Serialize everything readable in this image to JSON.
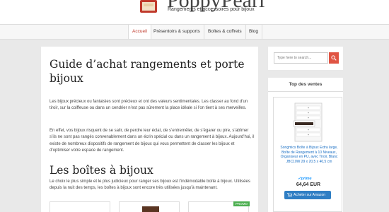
{
  "header": {
    "site_name": "PoppyPearl",
    "tagline": "Rangements et accessoires pour bijoux"
  },
  "nav": {
    "items": [
      {
        "label": "Accueil",
        "active": true
      },
      {
        "label": "Présentoirs & supports",
        "active": false
      },
      {
        "label": "Boîtes & coffrets",
        "active": false
      },
      {
        "label": "Blog",
        "active": false
      }
    ]
  },
  "article": {
    "title": "Guide d’achat rangements et porte bijoux",
    "paragraphs": [
      "Les bijoux précieux ou fantaisies sont précieux et ont des valeurs sentimentales. Les classer au fond d’un tiroir, sur la coiffeuse ou dans un cendrier n’est pas sûrement la place idéale si l’on tient à ses merveilles.",
      "En effet, vos bijoux risquent de se salir, de perdre leur éclat, de s’entremêler, de s’égarer ou pire, s’abîmer s’ils ne sont pas rangés convenablement dans un écrin spécial ou dans un rangement à bijoux. Aujourd’hui, il existe de nombreux dispositifs de rangement de bijoux qui vous permettent de classer les bijoux et d’optimiser votre espace de rangement."
    ],
    "section_title": "Les boîtes à bijoux",
    "section_paragraph": "Le choix le plus simple et le plus judicieux pour ranger ses bijoux est l’indémodable boîte à bijoux. Utilisées depuis la nuit des temps, les boîtes à bijoux sont encore très utilisées jusqu’à maintenant.",
    "promo_badge": "PROMO"
  },
  "sidebar": {
    "search_placeholder": "Type here to search...",
    "widget_title": "Top des ventes",
    "product": {
      "title": "Songmics Boîte à Bijoux Extra large, Boîte de Rangement à 10 Niveaux, Organiseur en PU, avec Tiroir, Blanc JBC10W 29 x 20,5 x 40,5 cm",
      "prime": "✓prime",
      "price": "64,64 EUR",
      "button_label": "Acheter sur Amazon"
    }
  },
  "colors": {
    "accent": "#c0392b",
    "search_button": "#e05443",
    "buy_button": "#2f7ec4",
    "promo": "#4caf50",
    "link": "#1a6fc4"
  }
}
